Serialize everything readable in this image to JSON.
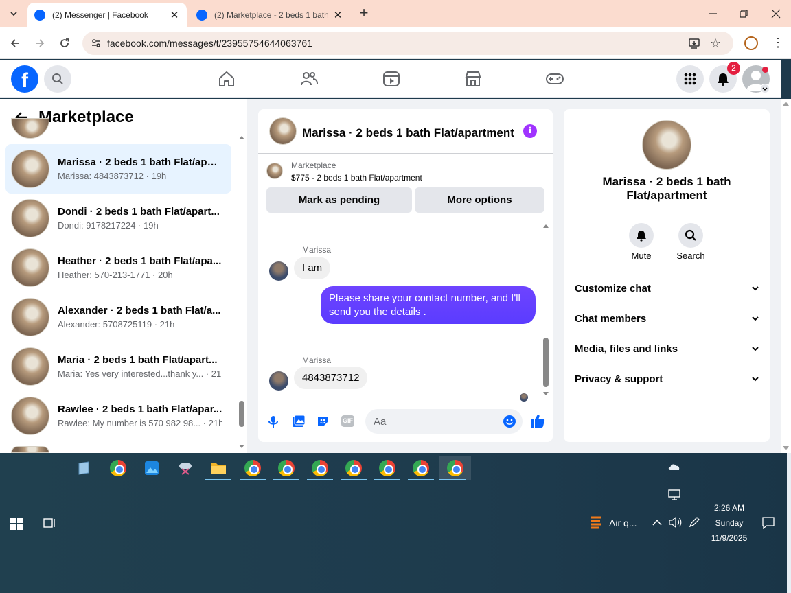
{
  "browser": {
    "tabs": [
      {
        "title": "(2) Messenger | Facebook",
        "active": true
      },
      {
        "title": "(2) Marketplace - 2 beds 1 bath",
        "active": false
      }
    ],
    "url": "facebook.com/messages/t/23955754644063761"
  },
  "fb": {
    "notification_count": "2"
  },
  "left_panel": {
    "title": "Marketplace",
    "conversations": [
      {
        "name": "Marissa · 2 beds 1 bath Flat/apar...",
        "preview": "Marissa: 4843873712 · 19h",
        "selected": true
      },
      {
        "name": "Dondi · 2 beds 1 bath Flat/apart...",
        "preview": "Dondi: 9178217224 · 19h",
        "selected": false
      },
      {
        "name": "Heather · 2 beds 1 bath Flat/apa...",
        "preview": "Heather: 570-213-1771 · 20h",
        "selected": false
      },
      {
        "name": "Alexander · 2 beds 1 bath Flat/a...",
        "preview": "Alexander: 5708725119 · 21h",
        "selected": false
      },
      {
        "name": "Maria · 2 beds 1 bath Flat/apart...",
        "preview": "Maria: Yes very interested...thank y... · 21h",
        "selected": false
      },
      {
        "name": "Rawlee · 2 beds 1 bath Flat/apar...",
        "preview": "Rawlee: My number is 570 982 98... · 21h",
        "selected": false
      }
    ]
  },
  "chat": {
    "title": "Marissa · 2 beds 1 bath Flat/apartment",
    "listing_label": "Marketplace",
    "listing_title": "$775 - 2 beds 1 bath Flat/apartment",
    "mark_pending": "Mark as pending",
    "more_options": "More options",
    "messages": [
      {
        "sender": "Marissa",
        "text": "I am",
        "direction": "in"
      },
      {
        "text": "Please share your contact number, and I'll send you the details .",
        "direction": "out"
      },
      {
        "sender": "Marissa",
        "text": "4843873712",
        "direction": "in"
      }
    ],
    "composer_placeholder": "Aa",
    "gif_label": "GIF"
  },
  "info_panel": {
    "name": "Marissa · 2 beds 1 bath Flat/apartment",
    "mute": "Mute",
    "search": "Search",
    "sections": [
      "Customize chat",
      "Chat members",
      "Media, files and links",
      "Privacy & support"
    ]
  },
  "taskbar": {
    "air_quality": "Air q...",
    "time": "2:26 AM",
    "day": "Sunday",
    "date": "11/9/2025"
  },
  "colors": {
    "fb_blue": "#0866ff",
    "outgoing_bubble": "#6e44ff",
    "selected_row": "#e7f3ff",
    "notification_badge": "#e41e3f"
  }
}
